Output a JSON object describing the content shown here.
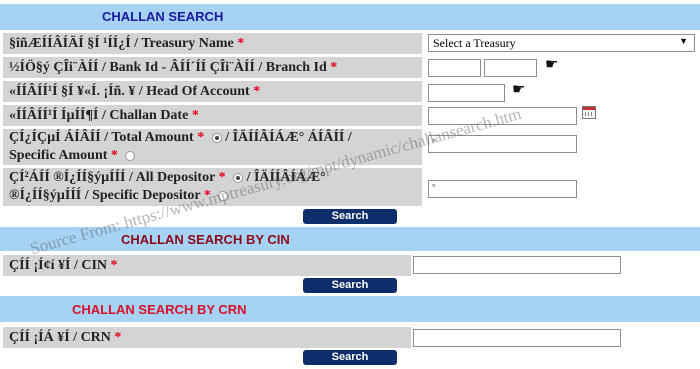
{
  "sections": {
    "challan_search": {
      "title": "CHALLAN SEARCH",
      "color": "#1a1aa0"
    },
    "by_cin": {
      "title": "CHALLAN SEARCH BY CIN",
      "color": "#8b0a1a"
    },
    "by_crn": {
      "title": "CHALLAN SEARCH BY CRN",
      "color": "#d8102a"
    }
  },
  "fields": {
    "treasury": {
      "label": "§îñÆÍÍÂÍÄÍ §Í ¹ÍÍ¿Í / Treasury Name",
      "required": "*",
      "selected": "Select a Treasury",
      "arrow": "▼"
    },
    "bank": {
      "label": "½ÍÖ§ý ÇÎi¨ÀÍÍ / Bank Id - ÂÍÍ´ÍÍ ÇÎi¨ÀÍÍ / Branch Id",
      "required": "*"
    },
    "head": {
      "label": "«ÍÍÂÍÍ¹Í §Í ¥«Í. ¡Íñ. ¥ / Head Of Account",
      "required": "*"
    },
    "date": {
      "label": "«ÍÍÂÍÍ¹Í ÍµÍÍ¶Í / Challan Date",
      "required": "*"
    },
    "amount": {
      "label_1": "ÇÍ¿ÍÇµÍ ÁÍÂÍÍ / Total Amount",
      "label_mid": "/ ÎÄÍÍÂÍÁÆ° ÁÍÂÍÍ /",
      "label_2": "Specific Amount",
      "required": "*",
      "input_hint": "*"
    },
    "depositor": {
      "label_1": "ÇÍ²ÁÍÍ ®Í¿ÍÍ§ýµÍÍÍ / All Depositor",
      "label_mid": "/ ÎÄÍÍÂÍÁÆ°",
      "label_2": "®Í¿ÍÍ§ýµÍÍÍ / Specific Depositor",
      "required": "*",
      "input_hint": "*"
    },
    "cin": {
      "label": "ÇÍÍ ¡Í¢í ¥Í / CIN",
      "required": "*"
    },
    "crn": {
      "label": "ÇÍÍ ¡ÍÁ ¥Í / CRN",
      "required": "*"
    }
  },
  "buttons": {
    "search_1": "Search",
    "search_2": "Search",
    "search_3": "Search"
  },
  "icons": {
    "hand": "☛"
  },
  "watermark": "Source From: https://www.mptreasury.org/mpt/dynamic/challansearch.htm"
}
